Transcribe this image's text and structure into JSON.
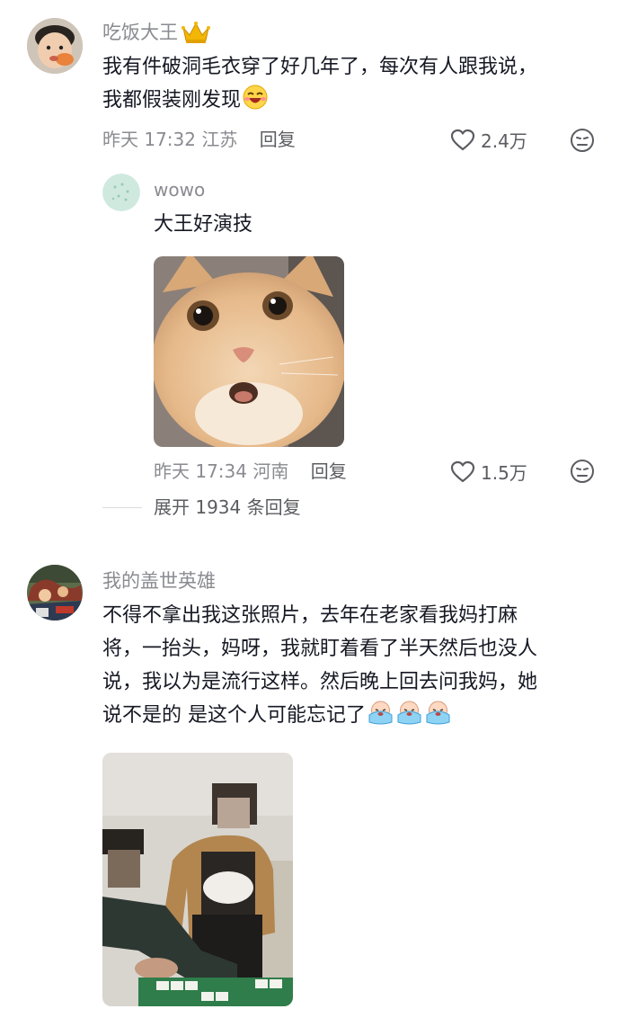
{
  "comments": [
    {
      "author": "吃饭大王",
      "text_line1": "我有件破洞毛衣穿了好几年了，每次有人跟我说，",
      "text_line2": "我都假装刚发现",
      "meta_time_location": "昨天 17:32 江苏",
      "reply_label": "回复",
      "likes": "2.4万",
      "replies": [
        {
          "author": "wowo",
          "text": "大王好演技",
          "meta_time_location": "昨天 17:34 河南",
          "reply_label": "回复",
          "likes": "1.5万"
        }
      ],
      "expand_label": "展开 1934 条回复"
    },
    {
      "author": "我的盖世英雄",
      "text_line1": "不得不拿出我这张照片，去年在老家看我妈打麻",
      "text_line2": "将，一抬头，妈呀，我就盯着看了半天然后也没人",
      "text_line3": "说，我以为是流行这样。然后晚上回去问我妈，她",
      "text_line4": "说不是的 是这个人可能忘记了"
    }
  ],
  "icons": {
    "crown": "crown-icon",
    "heart": "heart-icon",
    "dislike": "dislike-face-icon",
    "laugh": "laugh-emoji",
    "cry": "cry-emoji"
  },
  "colors": {
    "name_gray": "#8a8b91",
    "text_dark": "#161823",
    "crown_gold": "#f2b705"
  }
}
